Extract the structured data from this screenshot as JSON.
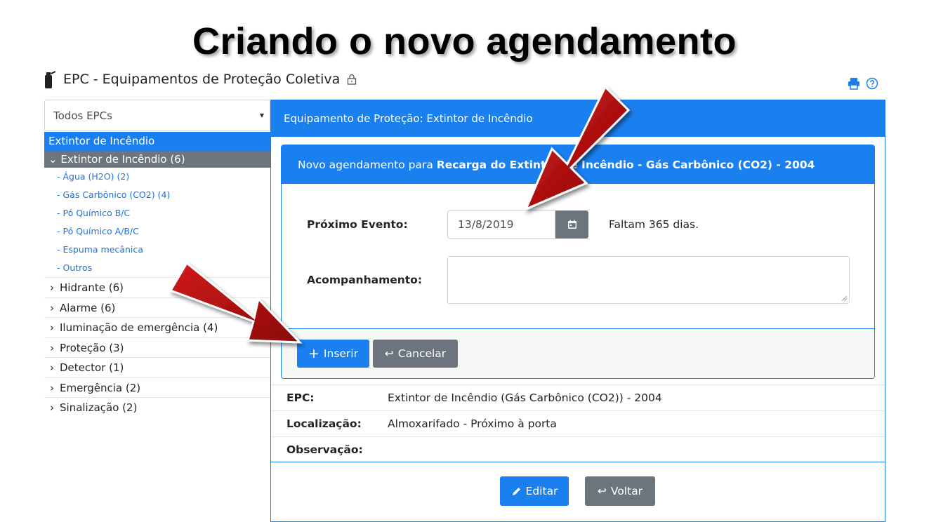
{
  "slide": {
    "title": "Criando o novo agendamento"
  },
  "header": {
    "app_title": "EPC - Equipamentos de Proteção Coletiva"
  },
  "sidebar": {
    "filter_value": "Todos EPCs",
    "category": "Extintor de Incêndio",
    "active_group": "Extintor de Incêndio (6)",
    "subitems": [
      "- Água (H2O) (2)",
      "- Gás Carbônico (CO2) (4)",
      "- Pó Químico B/C",
      "- Pó Químico A/B/C",
      "- Espuma mecânica",
      "- Outros"
    ],
    "groups": [
      "Hidrante (6)",
      "Alarme (6)",
      "Iluminação de emergência (4)",
      "Proteção (3)",
      "Detector (1)",
      "Emergência (2)",
      "Sinalização (2)"
    ]
  },
  "main": {
    "header": "Equipamento de Proteção: Extintor de Incêndio",
    "card": {
      "title_prefix": "Novo agendamento para ",
      "title_bold": "Recarga do Extintor de Incêndio - Gás Carbônico (CO2) - 2004",
      "proximo_label": "Próximo Evento:",
      "date_value": "13/8/2019",
      "faltam": "Faltam 365 dias.",
      "acompanhamento_label": "Acompanhamento:",
      "inserir_label": "Inserir",
      "cancelar_label": "Cancelar"
    },
    "info": [
      {
        "label": "EPC:",
        "value": "Extintor de Incêndio (Gás Carbônico (CO2)) - 2004"
      },
      {
        "label": "Localização:",
        "value": "Almoxarifado - Próximo à porta"
      },
      {
        "label": "Observação:",
        "value": ""
      }
    ],
    "editar_label": "Editar",
    "voltar_label": "Voltar"
  },
  "colors": {
    "primary": "#1a80f0",
    "secondary": "#6c757d",
    "arrow": "#b00d0d"
  },
  "icons": [
    "extinguisher-icon",
    "lock-icon",
    "print-icon",
    "help-icon",
    "calendar-icon",
    "plus-icon",
    "return-icon",
    "pencil-icon"
  ]
}
